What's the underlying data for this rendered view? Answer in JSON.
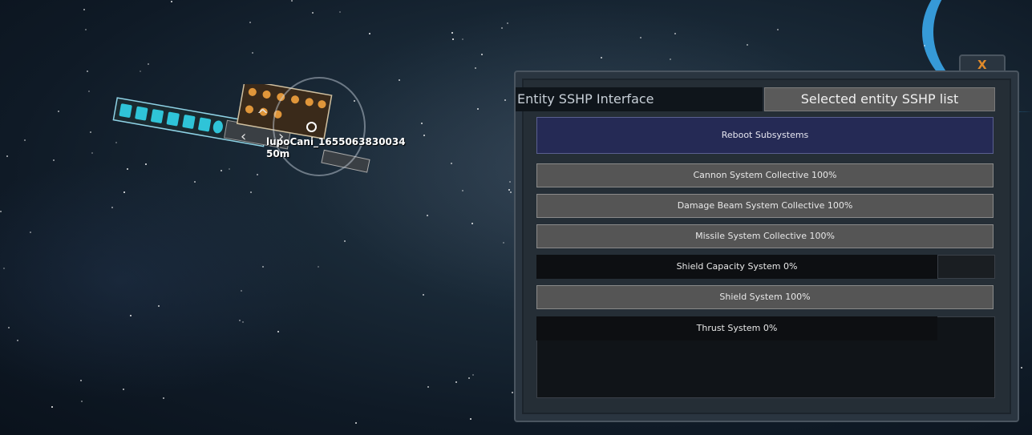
{
  "ship": {
    "name": "lupoCani_1655063830034",
    "distance": "50m"
  },
  "panel": {
    "tab_interface": "Entity SSHP Interface",
    "tab_list": "Selected entity SSHP list",
    "close_label": "X",
    "reboot_label": "Reboot Subsystems",
    "systems": [
      {
        "label": "Cannon System Collective 100%",
        "status": "full"
      },
      {
        "label": "Damage Beam System Collective 100%",
        "status": "full"
      },
      {
        "label": "Missile System Collective 100%",
        "status": "full"
      },
      {
        "label": "Shield Capacity System 0%",
        "status": "empty"
      },
      {
        "label": "Shield System 100%",
        "status": "full"
      },
      {
        "label": "Thrust System 0%",
        "status": "empty"
      }
    ]
  }
}
